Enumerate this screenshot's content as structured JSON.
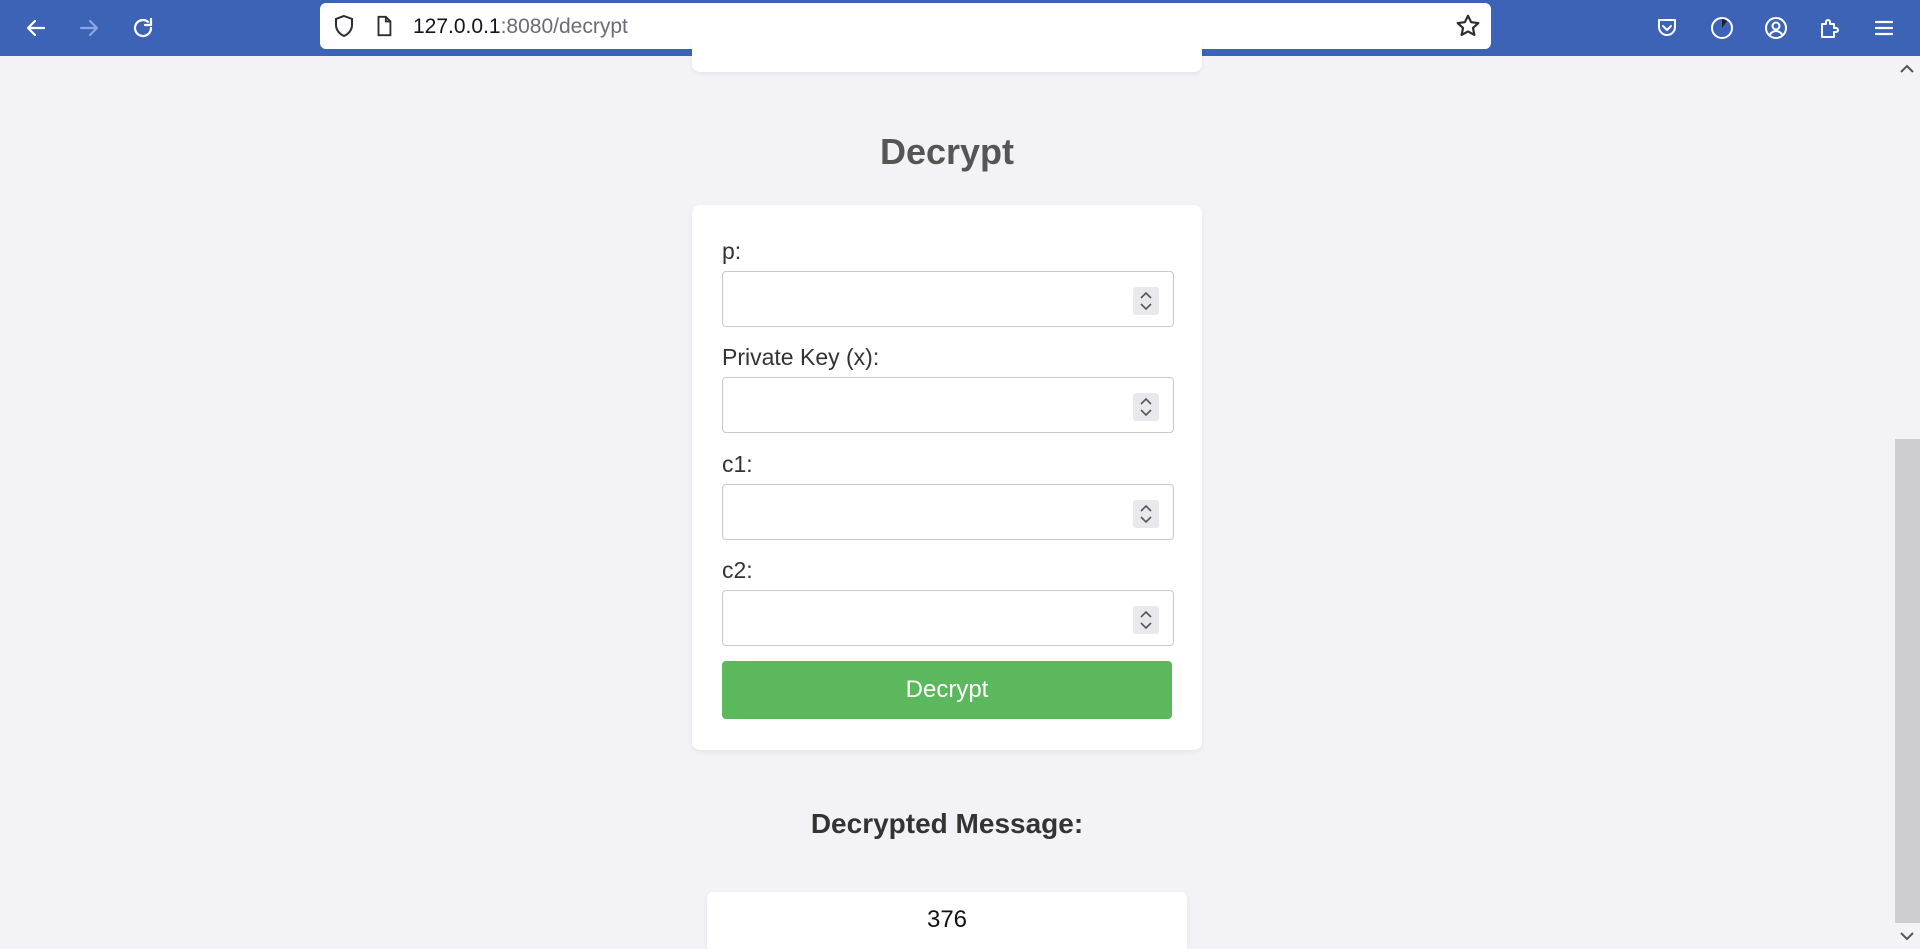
{
  "browser": {
    "url_host": "127.0.0.1",
    "url_path": ":8080/decrypt"
  },
  "page": {
    "title": "Decrypt"
  },
  "form": {
    "fields": [
      {
        "label": "p:",
        "value": ""
      },
      {
        "label": "Private Key (x):",
        "value": ""
      },
      {
        "label": "c1:",
        "value": ""
      },
      {
        "label": "c2:",
        "value": ""
      }
    ],
    "submit_label": "Decrypt"
  },
  "result": {
    "heading": "Decrypted Message:",
    "value": "376"
  },
  "colors": {
    "toolbar": "#3d63b6",
    "submit": "#5cb85c",
    "page_bg": "#f3f3f7"
  }
}
